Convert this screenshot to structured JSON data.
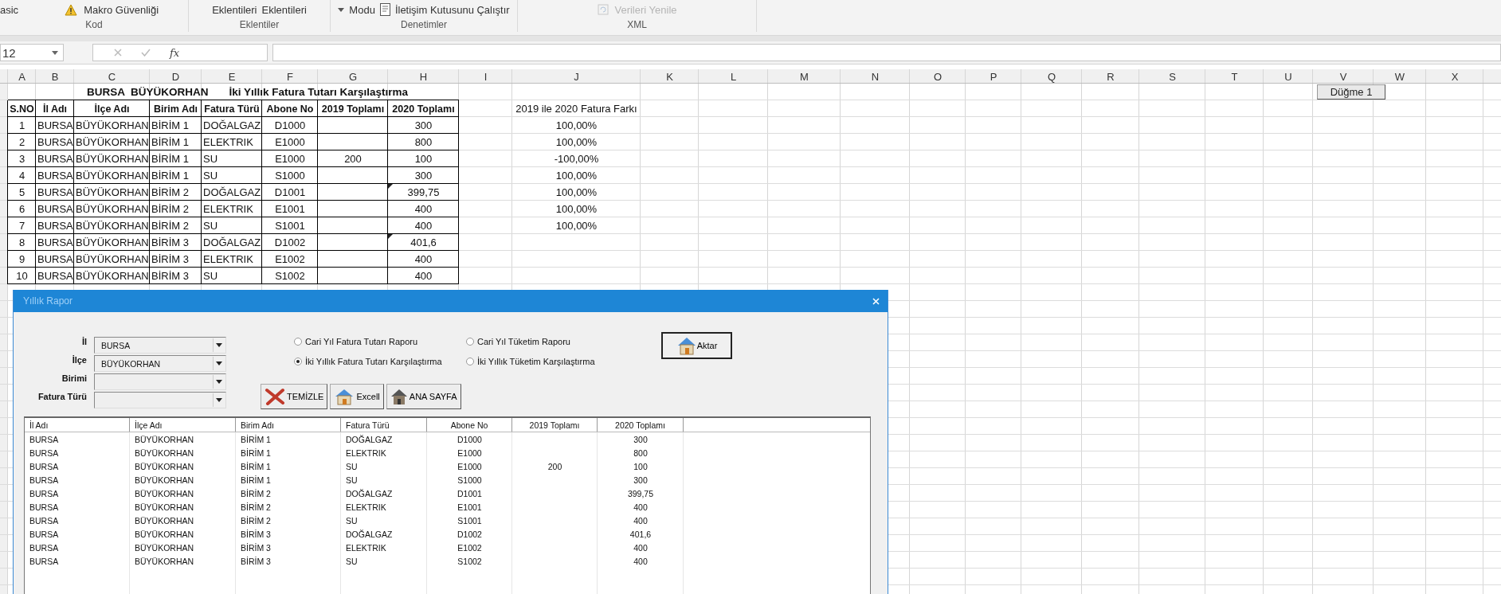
{
  "ribbon": {
    "groups": [
      {
        "label": "Kod",
        "items": [
          {
            "kind": "text",
            "label": "asic",
            "disabled": false
          },
          {
            "kind": "warning",
            "label": "Makro Güvenliği",
            "disabled": false
          }
        ]
      },
      {
        "label": "Eklentiler",
        "items": [
          {
            "kind": "text",
            "label": "Eklentileri",
            "disabled": false
          },
          {
            "kind": "text",
            "label": "Eklentileri",
            "disabled": false
          }
        ]
      },
      {
        "label": "Denetimler",
        "items": [
          {
            "kind": "caret",
            "disabled": false
          },
          {
            "kind": "text",
            "label": "Modu",
            "disabled": false
          },
          {
            "kind": "dialog",
            "label": "İletişim Kutusunu Çalıştır",
            "disabled": false
          }
        ]
      },
      {
        "label": "XML",
        "items": [
          {
            "kind": "refresh",
            "label": "Verileri Yenile",
            "disabled": true
          }
        ]
      }
    ]
  },
  "formula_bar": {
    "name_box": "12",
    "function_symbol": "fx"
  },
  "sheet": {
    "columns": [
      "A",
      "B",
      "C",
      "D",
      "E",
      "F",
      "G",
      "H",
      "I",
      "J",
      "K",
      "L",
      "M",
      "N",
      "O",
      "P",
      "Q",
      "R",
      "S",
      "T",
      "U",
      "V",
      "W",
      "X"
    ],
    "title_place": "BURSA  BÜYÜKORHAN",
    "title": "İki Yıllık Fatura Tutarı Karşılaştırma",
    "headers": [
      "S.NO",
      "İl Adı",
      "İlçe Adı",
      "Birim Adı",
      "Fatura Türü",
      "Abone No",
      "2019 Toplamı",
      "2020 Toplamı"
    ],
    "rows": [
      {
        "no": "1",
        "il": "BURSA",
        "ilce": "BÜYÜKORHAN",
        "birim": "BİRİM 1",
        "tur": "DOĞALGAZ",
        "abone": "D1000",
        "total_2020": "300",
        "comment": false
      },
      {
        "no": "2",
        "il": "BURSA",
        "ilce": "BÜYÜKORHAN",
        "birim": "BİRİM 1",
        "tur": "ELEKTRIK",
        "abone": "E1000",
        "total_2020": "800",
        "comment": false
      },
      {
        "no": "3",
        "il": "BURSA",
        "ilce": "BÜYÜKORHAN",
        "birim": "BİRİM 1",
        "tur": "SU",
        "abone": "E1000",
        "total_2019": "200",
        "total_2020": "100",
        "comment": false
      },
      {
        "no": "4",
        "il": "BURSA",
        "ilce": "BÜYÜKORHAN",
        "birim": "BİRİM 1",
        "tur": "SU",
        "abone": "S1000",
        "total_2020": "300",
        "comment": false
      },
      {
        "no": "5",
        "il": "BURSA",
        "ilce": "BÜYÜKORHAN",
        "birim": "BİRİM 2",
        "tur": "DOĞALGAZ",
        "abone": "D1001",
        "total_2020": "399,75",
        "comment": true
      },
      {
        "no": "6",
        "il": "BURSA",
        "ilce": "BÜYÜKORHAN",
        "birim": "BİRİM 2",
        "tur": "ELEKTRIK",
        "abone": "E1001",
        "total_2020": "400",
        "comment": false
      },
      {
        "no": "7",
        "il": "BURSA",
        "ilce": "BÜYÜKORHAN",
        "birim": "BİRİM 2",
        "tur": "SU",
        "abone": "S1001",
        "total_2020": "400",
        "comment": false
      },
      {
        "no": "8",
        "il": "BURSA",
        "ilce": "BÜYÜKORHAN",
        "birim": "BİRİM 3",
        "tur": "DOĞALGAZ",
        "abone": "D1002",
        "total_2020": "401,6",
        "comment": true
      },
      {
        "no": "9",
        "il": "BURSA",
        "ilce": "BÜYÜKORHAN",
        "birim": "BİRİM 3",
        "tur": "ELEKTRIK",
        "abone": "E1002",
        "total_2020": "400",
        "comment": false
      },
      {
        "no": "10",
        "il": "BURSA",
        "ilce": "BÜYÜKORHAN",
        "birim": "BİRİM 3",
        "tur": "SU",
        "abone": "S1002",
        "total_2020": "400",
        "comment": false
      }
    ],
    "difference_header": "2019 ile 2020 Fatura Farkı",
    "differences": [
      "100,00%",
      "100,00%",
      "-100,00%",
      "100,00%",
      "100,00%",
      "100,00%",
      "100,00%"
    ],
    "sheet_button": "Düğme 1"
  },
  "dialog": {
    "title": "Yıllık Rapor",
    "fields": [
      {
        "label": "İl",
        "value": "BURSA"
      },
      {
        "label": "İlçe",
        "value": "BÜYÜKORHAN"
      },
      {
        "label": "Birimi"
      },
      {
        "label": "Fatura Türü"
      }
    ],
    "report_options": [
      {
        "label": "Cari Yıl Fatura Tutarı Raporu",
        "selected": false
      },
      {
        "label": "Cari Yıl Tüketim Raporu",
        "selected": false
      },
      {
        "label": "İki Yıllık Fatura Tutarı Karşılaştırma",
        "selected": true
      },
      {
        "label": "İki Yıllık Tüketim Karşılaştırma",
        "selected": false
      }
    ],
    "export_button": "Aktar",
    "buttons": [
      {
        "kind": "clear",
        "label": "TEMİZLE"
      },
      {
        "kind": "excel",
        "label": "Excell"
      },
      {
        "kind": "home",
        "label": "ANA SAYFA"
      }
    ],
    "list": {
      "columns": [
        "İl Adı",
        "İlçe Adı",
        "Birim Adı",
        "Fatura Türü",
        "Abone No",
        "2019 Toplamı",
        "2020 Toplamı"
      ],
      "rows": [
        {
          "il": "BURSA",
          "ilce": "BÜYÜKORHAN",
          "birim": "BİRİM 1",
          "tur": "DOĞALGAZ",
          "abone": "D1000",
          "total_2020": "300"
        },
        {
          "il": "BURSA",
          "ilce": "BÜYÜKORHAN",
          "birim": "BİRİM 1",
          "tur": "ELEKTRIK",
          "abone": "E1000",
          "total_2020": "800"
        },
        {
          "il": "BURSA",
          "ilce": "BÜYÜKORHAN",
          "birim": "BİRİM 1",
          "tur": "SU",
          "abone": "E1000",
          "total_2019": "200",
          "total_2020": "100"
        },
        {
          "il": "BURSA",
          "ilce": "BÜYÜKORHAN",
          "birim": "BİRİM 1",
          "tur": "SU",
          "abone": "S1000",
          "total_2020": "300"
        },
        {
          "il": "BURSA",
          "ilce": "BÜYÜKORHAN",
          "birim": "BİRİM 2",
          "tur": "DOĞALGAZ",
          "abone": "D1001",
          "total_2020": "399,75"
        },
        {
          "il": "BURSA",
          "ilce": "BÜYÜKORHAN",
          "birim": "BİRİM 2",
          "tur": "ELEKTRIK",
          "abone": "E1001",
          "total_2020": "400"
        },
        {
          "il": "BURSA",
          "ilce": "BÜYÜKORHAN",
          "birim": "BİRİM 2",
          "tur": "SU",
          "abone": "S1001",
          "total_2020": "400"
        },
        {
          "il": "BURSA",
          "ilce": "BÜYÜKORHAN",
          "birim": "BİRİM 3",
          "tur": "DOĞALGAZ",
          "abone": "D1002",
          "total_2020": "401,6"
        },
        {
          "il": "BURSA",
          "ilce": "BÜYÜKORHAN",
          "birim": "BİRİM 3",
          "tur": "ELEKTRIK",
          "abone": "E1002",
          "total_2020": "400"
        },
        {
          "il": "BURSA",
          "ilce": "BÜYÜKORHAN",
          "birim": "BİRİM 3",
          "tur": "SU",
          "abone": "S1002",
          "total_2020": "400"
        }
      ]
    }
  }
}
